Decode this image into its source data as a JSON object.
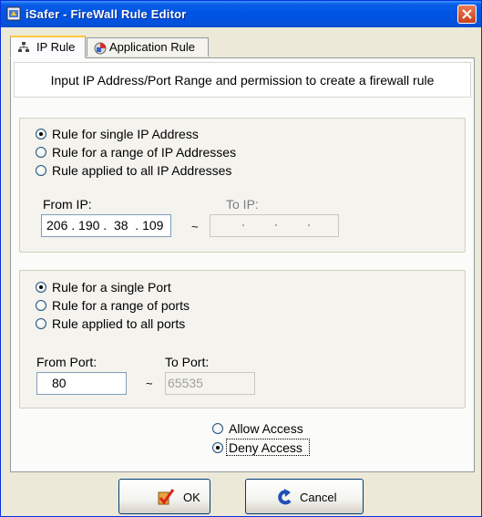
{
  "window": {
    "title": "iSafer - FireWall Rule Editor"
  },
  "tabs": [
    {
      "label": "IP Rule",
      "active": true
    },
    {
      "label": "Application Rule",
      "active": false
    }
  ],
  "banner": {
    "text": "Input IP Address/Port Range and permission to create a firewall rule"
  },
  "ip_section": {
    "options": [
      {
        "label": "Rule for single IP Address",
        "checked": true
      },
      {
        "label": "Rule for a range of IP Addresses",
        "checked": false
      },
      {
        "label": "Rule applied to all IP Addresses",
        "checked": false
      }
    ],
    "from_label": "From IP:",
    "to_label": "To IP:",
    "from_value": "206 . 190 .  38  . 109",
    "to_value": "",
    "range_separator": "~"
  },
  "port_section": {
    "options": [
      {
        "label": "Rule for a single Port",
        "checked": true
      },
      {
        "label": "Rule for a range of ports",
        "checked": false
      },
      {
        "label": "Rule applied to all ports",
        "checked": false
      }
    ],
    "from_label": "From Port:",
    "to_label": "To Port:",
    "from_value": "80",
    "to_value": "65535",
    "range_separator": "~"
  },
  "access": {
    "options": [
      {
        "label": "Allow Access",
        "checked": false
      },
      {
        "label": "Deny Access",
        "checked": true
      }
    ]
  },
  "buttons": {
    "ok": "OK",
    "cancel": "Cancel"
  },
  "colors": {
    "titlebar": "#0054e3",
    "face": "#ece9d8",
    "radio_check": "#21a121"
  },
  "icons": {
    "app": "shield-icon",
    "ip_tab": "network-icon",
    "app_tab": "application-icon",
    "ok": "check-icon",
    "cancel": "undo-arrow-icon"
  }
}
